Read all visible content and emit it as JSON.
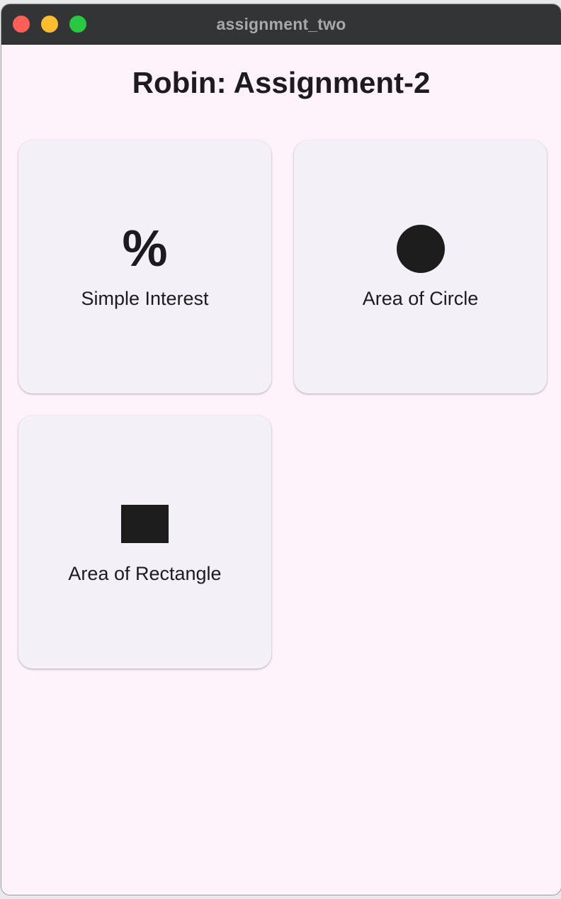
{
  "window": {
    "title": "assignment_two"
  },
  "app": {
    "title": "Robin: Assignment-2"
  },
  "cards": [
    {
      "icon": "percent-icon",
      "label": "Simple Interest"
    },
    {
      "icon": "circle-icon",
      "label": "Area of Circle"
    },
    {
      "icon": "rectangle-icon",
      "label": "Area of Rectangle"
    }
  ],
  "colors": {
    "background": "#fff3fb",
    "card": "#f4f0f7",
    "titlebar": "#323436",
    "text": "#1d1b20",
    "close": "#ff5f57",
    "minimize": "#febc2e",
    "maximize": "#28c840"
  }
}
